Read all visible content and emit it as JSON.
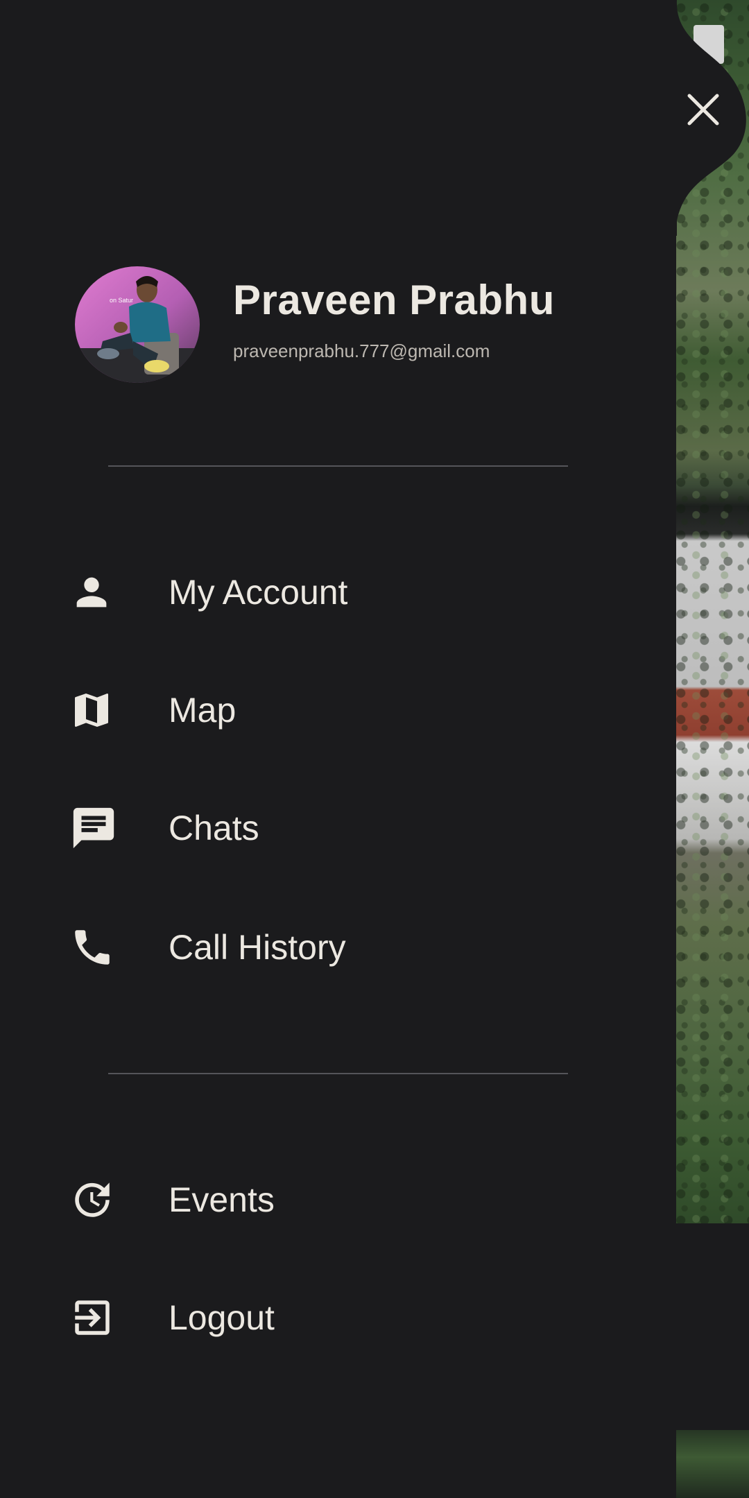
{
  "drawer": {
    "profile": {
      "name": "Praveen Prabhu",
      "email": "praveenprabhu.777@gmail.com"
    },
    "primary_items": [
      {
        "label": "My Account",
        "icon": "person-icon"
      },
      {
        "label": "Map",
        "icon": "map-icon"
      },
      {
        "label": "Chats",
        "icon": "chat-icon"
      },
      {
        "label": "Call History",
        "icon": "phone-icon"
      }
    ],
    "secondary_items": [
      {
        "label": "Events",
        "icon": "history-icon"
      },
      {
        "label": "Logout",
        "icon": "logout-icon"
      }
    ]
  },
  "colors": {
    "drawer_background": "#1b1b1d",
    "text_primary": "#ece8e1",
    "text_secondary": "#bdb8b1",
    "divider": "#55555a"
  }
}
